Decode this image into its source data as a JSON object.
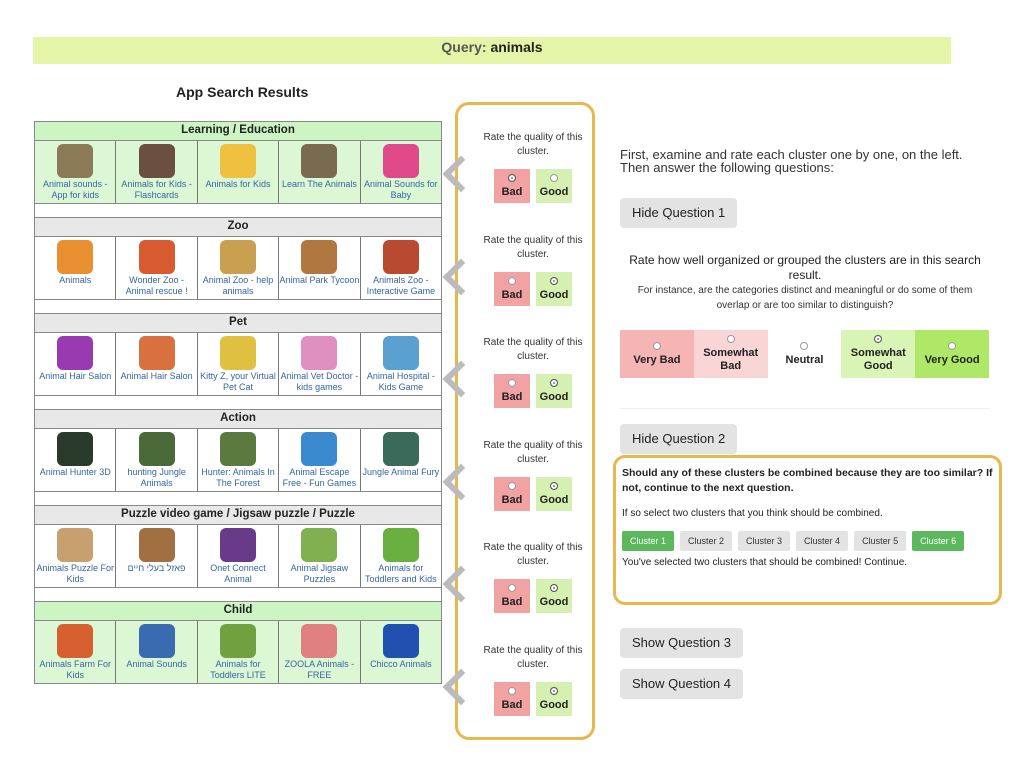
{
  "query": {
    "label": "Query:",
    "value": "animals"
  },
  "results_title": "App Search Results",
  "clusters": [
    {
      "name": "Learning / Education",
      "style": "green",
      "rating": "bad",
      "apps": [
        {
          "name": "Animal sounds - App for kids",
          "color": "#8a7a55"
        },
        {
          "name": "Animals for Kids - Flashcards",
          "color": "#6b5040"
        },
        {
          "name": "Animals for Kids",
          "color": "#f0c040"
        },
        {
          "name": "Learn The Animals",
          "color": "#7a6a50"
        },
        {
          "name": "Animal Sounds for Baby",
          "color": "#e04a8a"
        }
      ]
    },
    {
      "name": "Zoo",
      "style": "gray",
      "rating": "good",
      "apps": [
        {
          "name": "Animals",
          "color": "#e89030"
        },
        {
          "name": "Wonder Zoo - Animal rescue !",
          "color": "#d85a30"
        },
        {
          "name": "Animal Zoo - help animals",
          "color": "#c8a050"
        },
        {
          "name": "Animal Park Tycoon",
          "color": "#b07840"
        },
        {
          "name": "Animals Zoo - Interactive Game",
          "color": "#b84a30"
        }
      ]
    },
    {
      "name": "Pet",
      "style": "gray",
      "rating": "good",
      "apps": [
        {
          "name": "Animal Hair Salon",
          "color": "#9a3ab0"
        },
        {
          "name": "Animal Hair Salon",
          "color": "#d87040"
        },
        {
          "name": "Kitty Z, your Virtual Pet Cat",
          "color": "#e0c040"
        },
        {
          "name": "Animal Vet Doctor - kids games",
          "color": "#e090c0"
        },
        {
          "name": "Animal Hospital - Kids Game",
          "color": "#5aa0d0"
        }
      ]
    },
    {
      "name": "Action",
      "style": "gray",
      "rating": "good",
      "apps": [
        {
          "name": "Animal Hunter 3D",
          "color": "#2a3a2a"
        },
        {
          "name": "hunting Jungle Animals",
          "color": "#4a6a3a"
        },
        {
          "name": "Hunter: Animals In The Forest",
          "color": "#5a7a40"
        },
        {
          "name": "Animal Escape Free - Fun Games",
          "color": "#3a8ad0"
        },
        {
          "name": "Jungle Animal Fury",
          "color": "#3a6a5a"
        }
      ]
    },
    {
      "name": "Puzzle video game / Jigsaw puzzle / Puzzle",
      "style": "gray",
      "rating": "good",
      "apps": [
        {
          "name": "Animals Puzzle For Kids",
          "color": "#c8a070"
        },
        {
          "name": "פאזל בעלי חיים",
          "color": "#a07040"
        },
        {
          "name": "Onet Connect Animal",
          "color": "#6a3a8a"
        },
        {
          "name": "Animal Jigsaw Puzzles",
          "color": "#80b050"
        },
        {
          "name": "Animals for Toddlers and Kids",
          "color": "#6ab040"
        }
      ]
    },
    {
      "name": "Child",
      "style": "green",
      "rating": "good",
      "apps": [
        {
          "name": "Animals Farm For Kids",
          "color": "#d86030"
        },
        {
          "name": "Animal Sounds",
          "color": "#3a6ab0"
        },
        {
          "name": "Animals for Toddlers LITE",
          "color": "#70a040"
        },
        {
          "name": "ZOOLA Animals - FREE",
          "color": "#e08080"
        },
        {
          "name": "Chicco Animals",
          "color": "#2050b0"
        }
      ]
    }
  ],
  "rate": {
    "prompt": "Rate the quality of this cluster.",
    "bad": "Bad",
    "good": "Good"
  },
  "instructions": "First, examine and rate each cluster one by one, on the left. Then answer the following questions:",
  "q1": {
    "button": "Hide Question 1",
    "title": "Rate how well organized or grouped the clusters are in this search result.",
    "sub": "For instance, are the categories distinct and meaningful or do some of them overlap or are too similar to distinguish?",
    "scale": [
      {
        "label": "Very Bad",
        "color": "#f5b5b5",
        "selected": false
      },
      {
        "label": "Somewhat Bad",
        "color": "#f9d5d5",
        "selected": false
      },
      {
        "label": "Neutral",
        "color": "#ffffff",
        "selected": false
      },
      {
        "label": "Somewhat Good",
        "color": "#d8f5b5",
        "selected": true
      },
      {
        "label": "Very Good",
        "color": "#aee866",
        "selected": false
      }
    ]
  },
  "q2": {
    "button": "Hide Question 2",
    "title": "Should any of these clusters be combined because they are too similar? If not, continue to the next question.",
    "sub": "If so select two clusters that you think should be combined.",
    "clusters": [
      {
        "label": "Cluster 1",
        "selected": true
      },
      {
        "label": "Cluster 2",
        "selected": false
      },
      {
        "label": "Cluster 3",
        "selected": false
      },
      {
        "label": "Cluster 4",
        "selected": false
      },
      {
        "label": "Cluster 5",
        "selected": false
      },
      {
        "label": "Cluster 6",
        "selected": true
      }
    ],
    "status": "You've selected two clusters that should be combined! Continue."
  },
  "q3": {
    "button": "Show Question 3"
  },
  "q4": {
    "button": "Show Question 4"
  }
}
